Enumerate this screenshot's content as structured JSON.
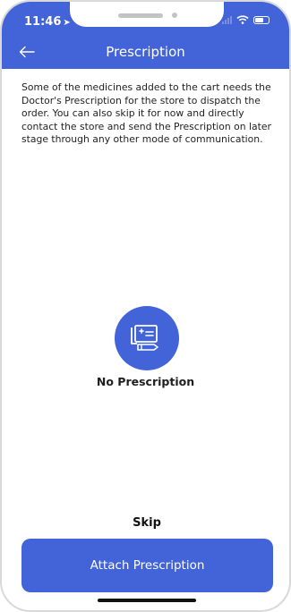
{
  "status_bar": {
    "time": "11:46",
    "location_arrow": "location-arrow-icon",
    "icons": [
      "signal-icon",
      "wifi-icon",
      "battery-icon"
    ]
  },
  "header": {
    "title": "Prescription",
    "back_icon": "back-arrow-icon"
  },
  "main": {
    "notice": "Some of the medicines added to the cart needs the Doctor's Prescription for the store to dispatch the order. You can also skip it for now and directly contact the store and send the Prescription on later stage through any other mode of communication.",
    "empty_state": {
      "icon": "prescription-icon",
      "label": "No Prescription"
    }
  },
  "actions": {
    "skip_label": "Skip",
    "attach_label": "Attach Prescription"
  },
  "colors": {
    "primary": "#4364d9",
    "text": "#1f1f1f",
    "background": "#ffffff"
  }
}
